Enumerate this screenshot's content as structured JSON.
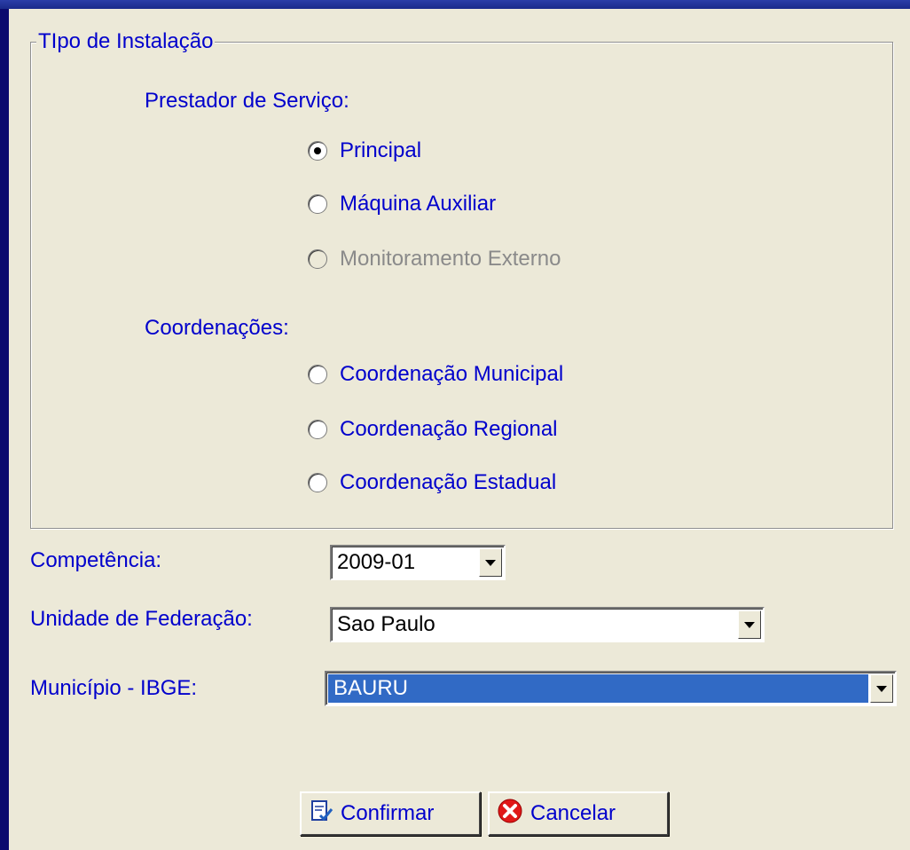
{
  "group": {
    "legend": "TIpo de Instalação",
    "prestador_label": "Prestador de Serviço:",
    "prestador_options": [
      {
        "label": "Principal",
        "checked": true,
        "disabled": false
      },
      {
        "label": "Máquina Auxiliar",
        "checked": false,
        "disabled": false
      },
      {
        "label": "Monitoramento Externo",
        "checked": false,
        "disabled": true
      }
    ],
    "coord_label": "Coordenações:",
    "coord_options": [
      {
        "label": "Coordenação Municipal",
        "checked": false,
        "disabled": false
      },
      {
        "label": "Coordenação Regional",
        "checked": false,
        "disabled": false
      },
      {
        "label": "Coordenação Estadual",
        "checked": false,
        "disabled": false
      }
    ]
  },
  "fields": {
    "competencia_label": "Competência:",
    "competencia_value": "2009-01",
    "uf_label": "Unidade de Federação:",
    "uf_value": "Sao Paulo",
    "municipio_label": "Município - IBGE:",
    "municipio_value": "BAURU"
  },
  "buttons": {
    "confirm_label": "Confirmar",
    "cancel_label": "Cancelar"
  },
  "colors": {
    "label_text": "#0000cc",
    "window_bg": "#ece9d8",
    "selection": "#316ac5",
    "outer_bg": "#0a0a6e"
  },
  "icons": {
    "confirm": "document-check-icon",
    "cancel": "red-x-circle-icon"
  }
}
